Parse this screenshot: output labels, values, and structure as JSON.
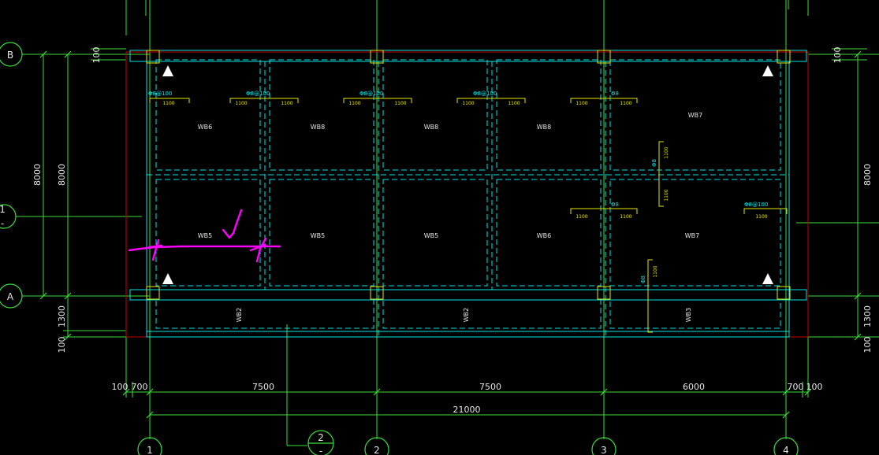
{
  "grid_labels": {
    "B": "B",
    "A": "A",
    "c1": "1",
    "c2": "2",
    "c3": "3",
    "c4": "4",
    "mid": "1",
    "mid_sub": "-",
    "c2_sub": "-"
  },
  "dims": {
    "d100_tl": "100",
    "d100_tr": "100",
    "d8000_l1": "8000",
    "d8000_l2": "8000",
    "d8000_r": "8000",
    "d1300_l": "1300",
    "d1300_r": "1300",
    "d100_bl": "100",
    "d100_br": "100",
    "b100_l": "100",
    "b700_l": "700",
    "b7500_1": "7500",
    "b7500_2": "7500",
    "b6000": "6000",
    "b700_r": "700",
    "b100_r": "100",
    "b21000": "21000"
  },
  "panels": {
    "wb6_a": "WB6",
    "wb8_a": "WB8",
    "wb8_b": "WB8",
    "wb8_c": "WB8",
    "wb7_a": "WB7",
    "wb5_a": "WB5",
    "wb5_b": "WB5",
    "wb5_c": "WB5",
    "wb6_b": "WB6",
    "wb7_b": "WB7",
    "wb2_a": "WB2",
    "wb2_b": "WB2",
    "wb3": "WB3"
  },
  "rebar": {
    "r1": "Φ8@100",
    "r2": "Φ8@100",
    "r3": "Φ8@100",
    "r4": "Φ8@100",
    "r5": "Φ8",
    "r6": "Φ8",
    "r7": "Φ8@100",
    "r8": "Φ8",
    "r9": "Φ8"
  },
  "rebar_len": {
    "l1100": "1100"
  },
  "colors": {
    "grid": "#3cdc3c",
    "outline": "#00e5e5",
    "rebar": "#e6e600",
    "annotation": "#ff00ff",
    "wall": "#c80000"
  }
}
